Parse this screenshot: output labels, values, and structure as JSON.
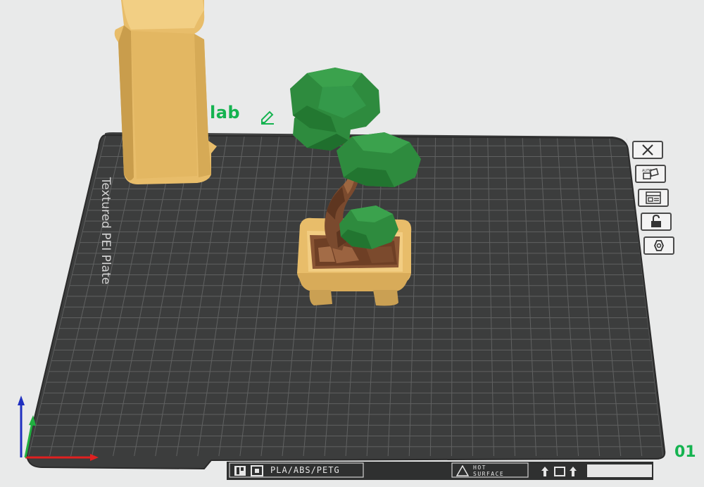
{
  "plate": {
    "brand_label": "lab",
    "type_label": "Textured PEI Plate",
    "material_label": "PLA/ABS/PETG",
    "hot_surface_line1": "HOT",
    "hot_surface_line2": "SURFACE",
    "plate_number": "01"
  },
  "toolbar": {
    "buttons": [
      {
        "name": "delete-plate",
        "icon": "close-icon"
      },
      {
        "name": "auto-arrange",
        "icon": "auto-arrange-icon",
        "text": "AUTO"
      },
      {
        "name": "plate-settings",
        "icon": "layout-icon"
      },
      {
        "name": "lock-plate",
        "icon": "unlock-icon"
      },
      {
        "name": "plate-options",
        "icon": "hexagon-icon"
      }
    ]
  },
  "colors": {
    "background": "#e9eaea",
    "plate_dark": "#3c3d3d",
    "grid_line": "#6b6d6d",
    "brand_green": "#15b350",
    "pot_tan": "#e8bd6a",
    "trunk_brown": "#7a4a2e",
    "foliage_green": "#2e8b3e",
    "axis_x": "#e02020",
    "axis_y": "#20b040",
    "axis_z": "#2030c0"
  }
}
